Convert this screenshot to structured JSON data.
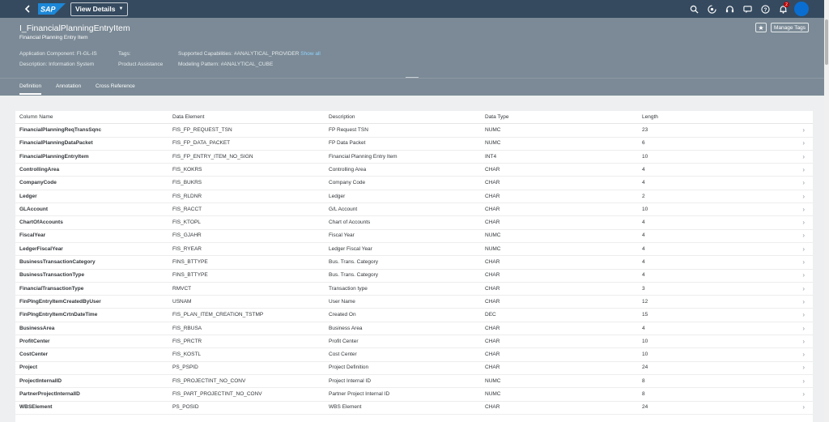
{
  "shell": {
    "logo_text": "SAP",
    "view_menu_label": "View Details",
    "notification_count": "2",
    "actions": [
      "search-icon",
      "copilot-icon",
      "headset-icon",
      "feedback-icon",
      "help-icon",
      "bell-icon"
    ]
  },
  "header": {
    "title": "I_FinancialPlanningEntryItem",
    "subtitle": "Financial Planning Entry Item",
    "app_component": "Application Component: FI-GL-IS",
    "description": "Description: Information System",
    "tags_label": "Tags:",
    "product_assistance": "Product Assistance",
    "supported_capabilities": "Supported Capabilities: #ANALYTICAL_PROVIDER",
    "show_all": "Show all",
    "modeling_pattern": "Modeling Pattern: #ANALYTICAL_CUBE",
    "manage_tags_label": "Manage Tags"
  },
  "tabs": [
    "Definition",
    "Annotation",
    "Cross Reference"
  ],
  "table": {
    "columns": [
      "Column Name",
      "Data Element",
      "Description",
      "Data Type",
      "Length"
    ],
    "rows": [
      [
        "FinancialPlanningReqTransSqnc",
        "FIS_FP_REQUEST_TSN",
        "FP Request TSN",
        "NUMC",
        "23"
      ],
      [
        "FinancialPlanningDataPacket",
        "FIS_FP_DATA_PACKET",
        "FP Data Packet",
        "NUMC",
        "6"
      ],
      [
        "FinancialPlanningEntryItem",
        "FIS_FP_ENTRY_ITEM_NO_SIGN",
        "Financial Planning Entry Item",
        "INT4",
        "10"
      ],
      [
        "ControllingArea",
        "FIS_KOKRS",
        "Controlling Area",
        "CHAR",
        "4"
      ],
      [
        "CompanyCode",
        "FIS_BUKRS",
        "Company Code",
        "CHAR",
        "4"
      ],
      [
        "Ledger",
        "FIS_RLDNR",
        "Ledger",
        "CHAR",
        "2"
      ],
      [
        "GLAccount",
        "FIS_RACCT",
        "G/L Account",
        "CHAR",
        "10"
      ],
      [
        "ChartOfAccounts",
        "FIS_KTOPL",
        "Chart of Accounts",
        "CHAR",
        "4"
      ],
      [
        "FiscalYear",
        "FIS_GJAHR",
        "Fiscal Year",
        "NUMC",
        "4"
      ],
      [
        "LedgerFiscalYear",
        "FIS_RYEAR",
        "Ledger Fiscal Year",
        "NUMC",
        "4"
      ],
      [
        "BusinessTransactionCategory",
        "FINS_BTTYPE",
        "Bus. Trans. Category",
        "CHAR",
        "4"
      ],
      [
        "BusinessTransactionType",
        "FINS_BTTYPE",
        "Bus. Trans. Category",
        "CHAR",
        "4"
      ],
      [
        "FinancialTransactionType",
        "RMVCT",
        "Transaction type",
        "CHAR",
        "3"
      ],
      [
        "FinPlngEntryItemCreatedByUser",
        "USNAM",
        "User Name",
        "CHAR",
        "12"
      ],
      [
        "FinPlngEntryItemCrtnDateTime",
        "FIS_PLAN_ITEM_CREATION_TSTMP",
        "Created On",
        "DEC",
        "15"
      ],
      [
        "BusinessArea",
        "FIS_RBUSA",
        "Business Area",
        "CHAR",
        "4"
      ],
      [
        "ProfitCenter",
        "FIS_PRCTR",
        "Profit Center",
        "CHAR",
        "10"
      ],
      [
        "CostCenter",
        "FIS_KOSTL",
        "Cost Center",
        "CHAR",
        "10"
      ],
      [
        "Project",
        "PS_PSPID",
        "Project Definition",
        "CHAR",
        "24"
      ],
      [
        "ProjectInternalID",
        "FIS_PROJECTINT_NO_CONV",
        "Project Internal ID",
        "NUMC",
        "8"
      ],
      [
        "PartnerProjectInternalID",
        "FIS_PART_PROJECTINT_NO_CONV",
        "Partner Project Internal ID",
        "NUMC",
        "8"
      ],
      [
        "WBSElement",
        "PS_POSID",
        "WBS Element",
        "CHAR",
        "24"
      ]
    ]
  },
  "colors": {
    "shell_bg": "#354a5f",
    "header_bg": "#7b8a96",
    "link": "#8fd3ff",
    "avatar": "#0a6ed1"
  }
}
